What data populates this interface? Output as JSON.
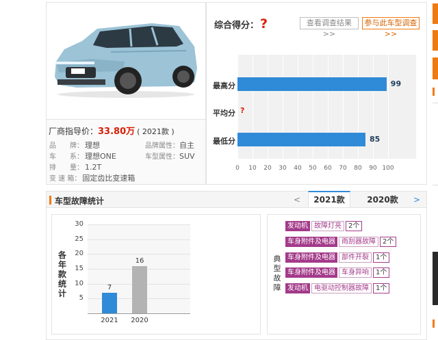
{
  "car": {
    "price_label": "厂商指导价：",
    "price_value": "33.80万",
    "price_year": "( 2021款 )",
    "specs": [
      {
        "label": "品　　牌：",
        "value": "理想"
      },
      {
        "label": "品牌属性：",
        "value": "自主"
      },
      {
        "label": "车　　系：",
        "value": "理想ONE"
      },
      {
        "label": "车型属性：",
        "value": "SUV"
      },
      {
        "label": "排　　量：",
        "value": "1.2T"
      },
      {
        "label": "变 速 箱：",
        "value": "固定齿比变速箱"
      }
    ]
  },
  "score": {
    "title": "综合得分：",
    "score_value": "?",
    "view_results_button": "查看调查结果>>",
    "join_survey_button": "参与此车型调查>>",
    "max_label": "最高分",
    "avg_label": "平均分",
    "min_label": "最低分"
  },
  "fault_section": {
    "title": "车型故障统计",
    "prev_arrow": "<",
    "next_arrow": ">",
    "tabs": [
      {
        "label": "2021款"
      },
      {
        "label": "2020款"
      }
    ],
    "chart_ylabel": [
      "各",
      "年",
      "款",
      "统",
      "计"
    ],
    "typical_label": [
      "典",
      "型",
      "故",
      "障"
    ],
    "faults": [
      {
        "category": "发动机",
        "name": "故障灯亮",
        "count": "2个"
      },
      {
        "category": "车身附件及电器",
        "name": "雨刮器故障",
        "count": "2个"
      },
      {
        "category": "车身附件及电器",
        "name": "部件开裂",
        "count": "1个"
      },
      {
        "category": "车身附件及电器",
        "name": "车身异响",
        "count": "1个"
      },
      {
        "category": "发动机",
        "name": "电驱动控制器故障",
        "count": "1个"
      }
    ]
  },
  "colors": {
    "accent_orange": "#f07a10",
    "price_red": "#d81e06",
    "bar_blue": "#2f8ad7",
    "bar_gray": "#b3b3b3",
    "fault_purple": "#a33a8a"
  },
  "chart_data": [
    {
      "type": "bar",
      "orientation": "horizontal",
      "categories": [
        "最高分",
        "平均分",
        "最低分"
      ],
      "values": [
        99,
        null,
        85
      ],
      "value_labels": [
        "99",
        "?",
        "85"
      ],
      "xlim": [
        0,
        100
      ],
      "xticks": [
        0,
        10,
        20,
        30,
        40,
        50,
        60,
        70,
        80,
        90,
        100
      ],
      "grid": true
    },
    {
      "type": "bar",
      "categories": [
        "2021",
        "2020"
      ],
      "values": [
        7,
        16
      ],
      "ylim": [
        0,
        30
      ],
      "yticks": [
        5,
        10,
        15,
        20,
        25,
        30
      ],
      "colors": [
        "#2f8ad7",
        "#b3b3b3"
      ],
      "grid": true
    }
  ]
}
